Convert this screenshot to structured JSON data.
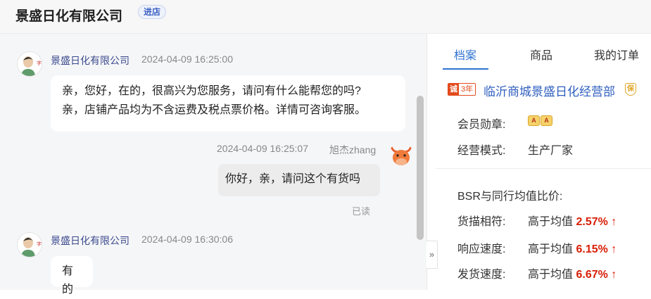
{
  "header": {
    "shop_name": "景盛日化有限公司",
    "enter_badge": "进店"
  },
  "chat": {
    "messages": [
      {
        "sender": "景盛日化有限公司",
        "time": "2024-04-09 16:25:00",
        "lines": [
          "亲，您好，在的，很高兴为您服务，请问有什么能帮您的吗?",
          "亲，店铺产品均为不含运费及税点票价格。详情可咨询客服。"
        ]
      },
      {
        "sender": "旭杰zhang",
        "time": "2024-04-09 16:25:07",
        "text": "你好，亲，请问这个有货吗",
        "status": "已读"
      },
      {
        "sender": "景盛日化有限公司",
        "time": "2024-04-09 16:30:06",
        "text": "有的"
      }
    ]
  },
  "panel": {
    "tabs": [
      {
        "label": "档案",
        "active": true
      },
      {
        "label": "商品",
        "active": false
      },
      {
        "label": "我的订单",
        "active": false
      }
    ],
    "store": {
      "years_icon": "诚",
      "years_text": "3年",
      "full_name": "临沂商城景盛日化经营部",
      "shield_text": "保"
    },
    "info": [
      {
        "label": "会员勋章:",
        "badge_text": "A"
      },
      {
        "label": "经营模式:",
        "value": "生产厂家"
      }
    ],
    "bsr": {
      "title": "BSR与同行均值比价:",
      "rows": [
        {
          "label": "货描相符:",
          "compare": "高于均值",
          "pct": "2.57%",
          "arrow": "↑"
        },
        {
          "label": "响应速度:",
          "compare": "高于均值",
          "pct": "6.15%",
          "arrow": "↑"
        },
        {
          "label": "发货速度:",
          "compare": "高于均值",
          "pct": "6.67%",
          "arrow": "↑"
        }
      ]
    }
  },
  "icons": {
    "collapse": "»",
    "accent": "#2f73d0",
    "danger": "#d81e06"
  }
}
